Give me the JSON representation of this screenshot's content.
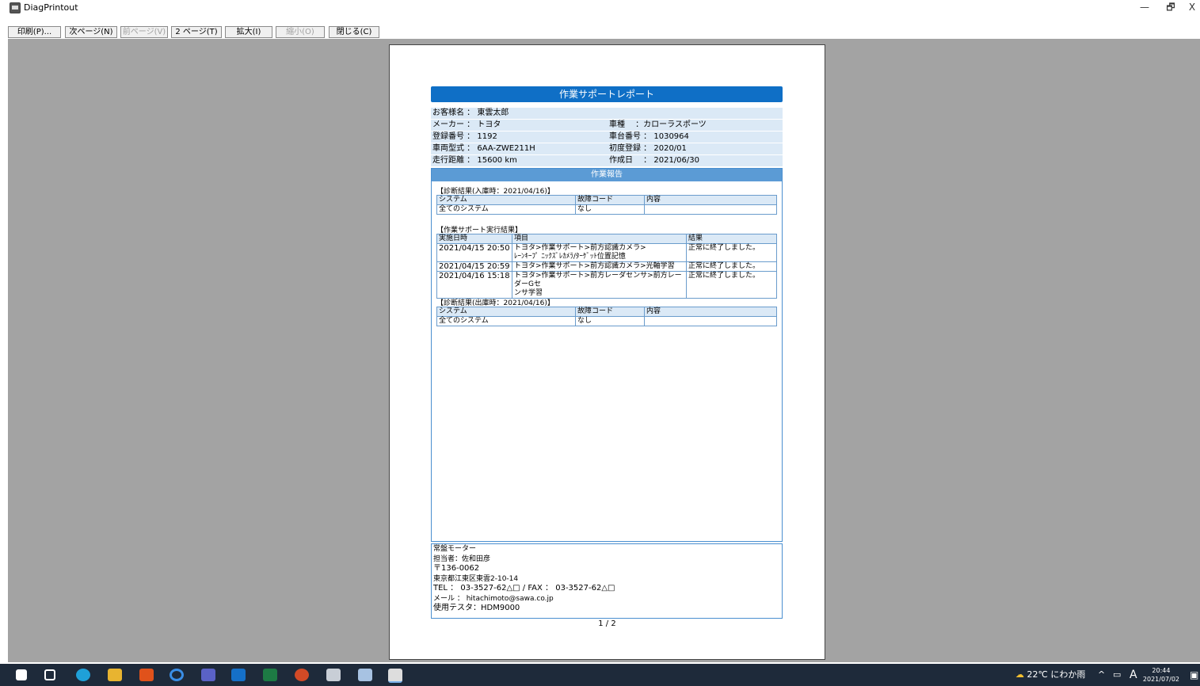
{
  "window": {
    "title": "DiagPrintout",
    "minimize": "—",
    "restore": "🗗",
    "close": "X"
  },
  "toolbar": {
    "buttons": [
      {
        "label": "印刷(P)...",
        "enabled": true
      },
      {
        "label": "次ページ(N)",
        "enabled": true
      },
      {
        "label": "前ページ(V)",
        "enabled": false
      },
      {
        "label": "2 ページ(T)",
        "enabled": true
      },
      {
        "label": "拡大(I)",
        "enabled": true
      },
      {
        "label": "縮小(O)",
        "enabled": false
      },
      {
        "label": "閉じる(C)",
        "enabled": true
      }
    ]
  },
  "report": {
    "title": "作業サポートレポート",
    "customer": "お客様名 ： 東雲太郎",
    "maker": "メーカー ： トヨタ",
    "model": "車種 　：カローラスポーツ",
    "reg_no": "登録番号 ： 1192",
    "chassis_no": "車台番号 ： 1030964",
    "vehicle_type": "車両型式 ： 6AA-ZWE211H",
    "first_reg": "初度登録 ： 2020/01",
    "mileage": "走行距離 ： 15600 km",
    "created": "作成日 　： 2021/06/30",
    "work_report_heading": "作業報告",
    "diag_in": {
      "label": "【診断結果(入庫時：2021/04/16)】",
      "headers": [
        "システム",
        "故障コード",
        "内容"
      ],
      "rows": [
        [
          "全てのシステム",
          "なし",
          ""
        ]
      ]
    },
    "support": {
      "label": "【作業サポート実行結果】",
      "headers": [
        "実施日時",
        "項目",
        "結果"
      ],
      "rows": [
        [
          "2021/04/15 20:50",
          "トヨタ>作業サポート>前方認識カメラ>\nﾚｰﾝｷｰﾌﾟ ﾆｯｸｽﾞﾚｶﾒﾗ/ﾀｰｹﾞｯﾄ位置記憶",
          "正常に終了しました。"
        ],
        [
          "2021/04/15 20:59",
          "トヨタ>作業サポート>前方認識カメラ>光軸学習",
          "正常に終了しました。"
        ],
        [
          "2021/04/16 15:18",
          "トヨタ>作業サポート>前方レーダセンサ>前方レーダーGセ\nンサ学習",
          "正常に終了しました。"
        ]
      ]
    },
    "diag_out": {
      "label": "【診断結果(出庫時：2021/04/16)】",
      "headers": [
        "システム",
        "故障コード",
        "内容"
      ],
      "rows": [
        [
          "全てのシステム",
          "なし",
          ""
        ]
      ]
    },
    "footer": {
      "company": "常盤モーター",
      "person": "担当者：佐和田彦",
      "postal": "〒136-0062",
      "address": "東京都江東区東雲2-10-14",
      "phone": "TEL ： 03-3527-62△□ / FAX ： 03-3527-62△□",
      "email": "メール ： hitachimoto@sawa.co.jp",
      "tester": "使用テスタ：HDM9000"
    },
    "page_number": "1 / 2"
  },
  "taskbar": {
    "weather": "22℃ にわか雨",
    "ime": "A",
    "time": "20:44",
    "date": "2021/07/02"
  }
}
